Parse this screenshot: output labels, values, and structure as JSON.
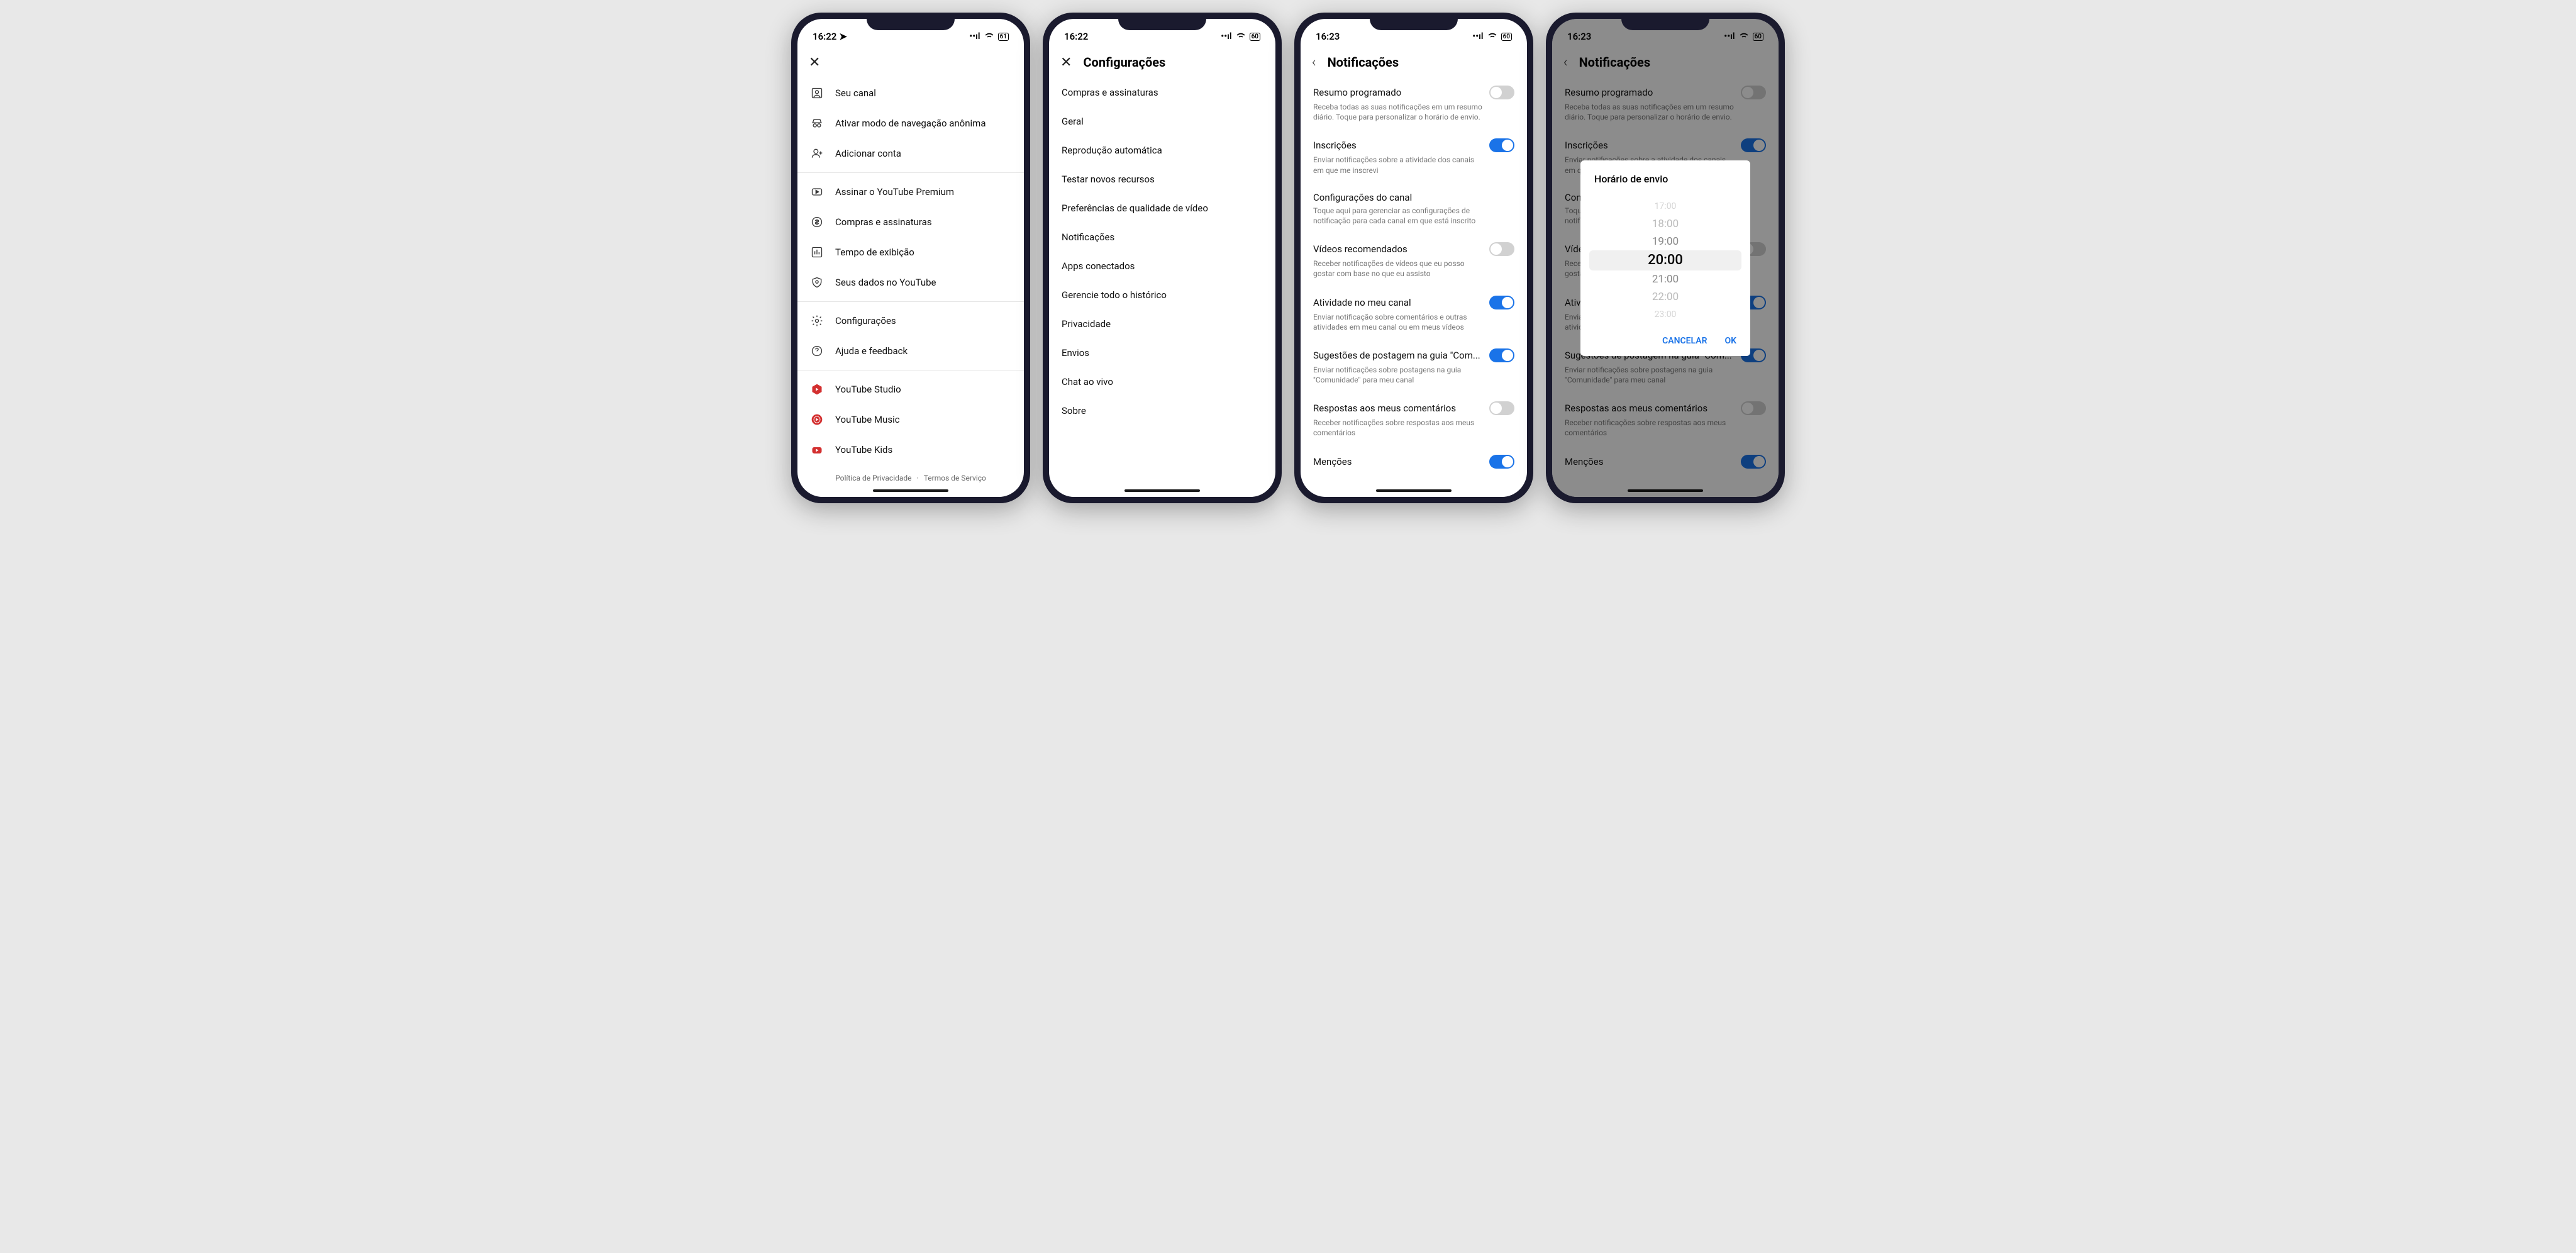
{
  "status": {
    "time1": "16:22",
    "time2": "16:22",
    "time3": "16:23",
    "time4": "16:23",
    "battery1": "61",
    "battery2": "60",
    "battery3": "60",
    "battery4": "60"
  },
  "screen1": {
    "items_a": [
      {
        "label": "Seu canal",
        "icon": "person-square"
      },
      {
        "label": "Ativar modo de navegação anônima",
        "icon": "incognito"
      },
      {
        "label": "Adicionar conta",
        "icon": "person-plus"
      }
    ],
    "items_b": [
      {
        "label": "Assinar o YouTube Premium",
        "icon": "youtube"
      },
      {
        "label": "Compras e assinaturas",
        "icon": "dollar"
      },
      {
        "label": "Tempo de exibição",
        "icon": "chart"
      },
      {
        "label": "Seus dados no YouTube",
        "icon": "shield"
      }
    ],
    "items_c": [
      {
        "label": "Configurações",
        "icon": "gear"
      },
      {
        "label": "Ajuda e feedback",
        "icon": "help"
      }
    ],
    "items_d": [
      {
        "label": "YouTube Studio",
        "icon": "studio"
      },
      {
        "label": "YouTube Music",
        "icon": "music"
      },
      {
        "label": "YouTube Kids",
        "icon": "kids"
      }
    ],
    "footer": {
      "privacy": "Política de Privacidade",
      "dot": "·",
      "terms": "Termos de Serviço"
    }
  },
  "screen2": {
    "title": "Configurações",
    "items": [
      "Compras e assinaturas",
      "Geral",
      "Reprodução automática",
      "Testar novos recursos",
      "Preferências de qualidade de vídeo",
      "Notificações",
      "Apps conectados",
      "Gerencie todo o histórico",
      "Privacidade",
      "Envios",
      "Chat ao vivo",
      "Sobre"
    ]
  },
  "screen3": {
    "title": "Notificações",
    "items": [
      {
        "title": "Resumo programado",
        "desc": "Receba todas as suas notificações em um resumo diário. Toque para personalizar o horário de envio.",
        "toggle": "off"
      },
      {
        "title": "Inscrições",
        "desc": "Enviar notificações sobre a atividade dos canais em que me inscrevi",
        "toggle": "on"
      },
      {
        "title": "Configurações do canal",
        "desc": "Toque aqui para gerenciar as configurações de notificação para cada canal em que está inscrito",
        "toggle": null
      },
      {
        "title": "Vídeos recomendados",
        "desc": "Receber notificações de vídeos que eu posso gostar com base no que eu assisto",
        "toggle": "off"
      },
      {
        "title": "Atividade no meu canal",
        "desc": "Enviar notificação sobre comentários e outras atividades em meu canal ou em meus vídeos",
        "toggle": "on"
      },
      {
        "title": "Sugestões de postagem na guia \"Com...",
        "desc": "Enviar notificações sobre postagens na guia \"Comunidade\" para meu canal",
        "toggle": "on"
      },
      {
        "title": "Respostas aos meus comentários",
        "desc": "Receber notificações sobre respostas aos meus comentários",
        "toggle": "off"
      },
      {
        "title": "Menções",
        "desc": "",
        "toggle": "on"
      }
    ]
  },
  "screen4": {
    "dialog": {
      "title": "Horário de envio",
      "options": [
        "17:00",
        "18:00",
        "19:00",
        "20:00",
        "21:00",
        "22:00",
        "23:00"
      ],
      "selected": "20:00",
      "cancel": "CANCELAR",
      "ok": "OK"
    }
  }
}
